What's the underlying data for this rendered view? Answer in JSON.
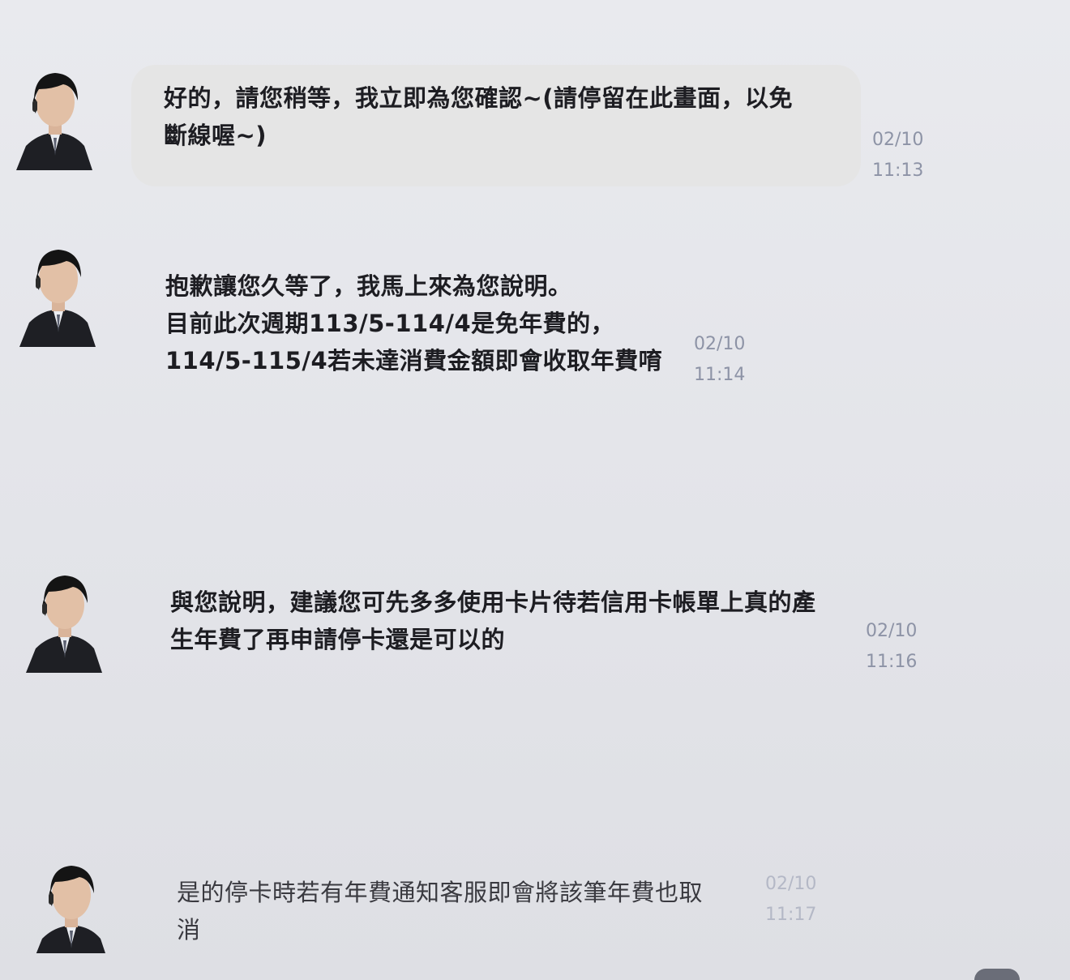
{
  "messages": [
    {
      "text": "好的，請您稍等，我立即為您確認~(請停留在此畫面，以免\n斷線喔~)",
      "date": "02/10",
      "time": "11:13"
    },
    {
      "text": "抱歉讓您久等了，我馬上來為您說明。\n目前此次週期113/5-114/4是免年費的，\n114/5-115/4若未達消費金額即會收取年費唷",
      "date": "02/10",
      "time": "11:14"
    },
    {
      "text": "與您說明，建議您可先多多使用卡片待若信用卡帳單上真的產\n生年費了再申請停卡還是可以的",
      "date": "02/10",
      "time": "11:16"
    },
    {
      "text": "是的停卡時若有年費通知客服即會將該筆年費也取消",
      "date": "02/10",
      "time": "11:17"
    }
  ],
  "colors": {
    "background": "#e6e7eb",
    "bubble": "#e5e5e5",
    "text": "#1d1d22",
    "timestamp": "#8d93a6"
  }
}
